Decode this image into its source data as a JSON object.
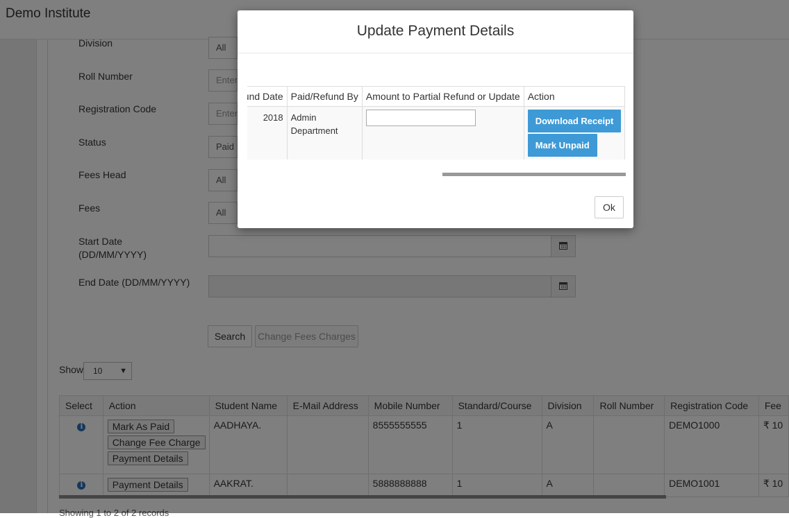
{
  "app": {
    "title": "Demo Institute"
  },
  "filters": {
    "division": {
      "label": "Division",
      "value": "All"
    },
    "roll_number": {
      "label": "Roll Number",
      "placeholder": "Enter"
    },
    "registration_code": {
      "label": "Registration Code",
      "placeholder": "Enter"
    },
    "status": {
      "label": "Status",
      "value": "Paid"
    },
    "fees_head": {
      "label": "Fees Head",
      "value": "All"
    },
    "fees": {
      "label": "Fees",
      "value": "All"
    },
    "start_date": {
      "label_line1": "Start Date",
      "label_line2": "(DD/MM/YYYY)"
    },
    "end_date": {
      "label": "End Date (DD/MM/YYYY)"
    },
    "search_label": "Search",
    "change_fees_label": "Change Fees Charges"
  },
  "list": {
    "show_label": "Show",
    "page_size": "10",
    "showing_text": "Showing 1 to 2 of 2 records"
  },
  "table": {
    "headers": [
      "Select",
      "Action",
      "Student Name",
      "E-Mail Address",
      "Mobile Number",
      "Standard/Course",
      "Division",
      "Roll Number",
      "Registration Code",
      "Fee"
    ],
    "rows": [
      {
        "actions": [
          "Mark As Paid",
          "Change Fee Charge",
          "Payment Details"
        ],
        "student_name": "AADHAYA.",
        "email": "",
        "mobile": "8555555555",
        "standard": "1",
        "division": "A",
        "roll": "",
        "registration_code": "DEMO1000",
        "fee": "₹ 10"
      },
      {
        "actions": [
          "Payment Details"
        ],
        "student_name": "AAKRAT.",
        "email": "",
        "mobile": "5888888888",
        "standard": "1",
        "division": "A",
        "roll": "",
        "registration_code": "DEMO1001",
        "fee": "₹ 10"
      }
    ]
  },
  "modal": {
    "title": "Update Payment Details",
    "headers": [
      "Refund Date",
      "Paid/Refund By",
      "Amount to Partial Refund or Update",
      "Action"
    ],
    "row": {
      "refund_date": "2018",
      "paid_by_line1": "Admin",
      "paid_by_line2": "Department",
      "amount": ""
    },
    "download_label": "Download Receipt",
    "mark_unpaid_label": "Mark Unpaid",
    "ok_label": "Ok"
  }
}
